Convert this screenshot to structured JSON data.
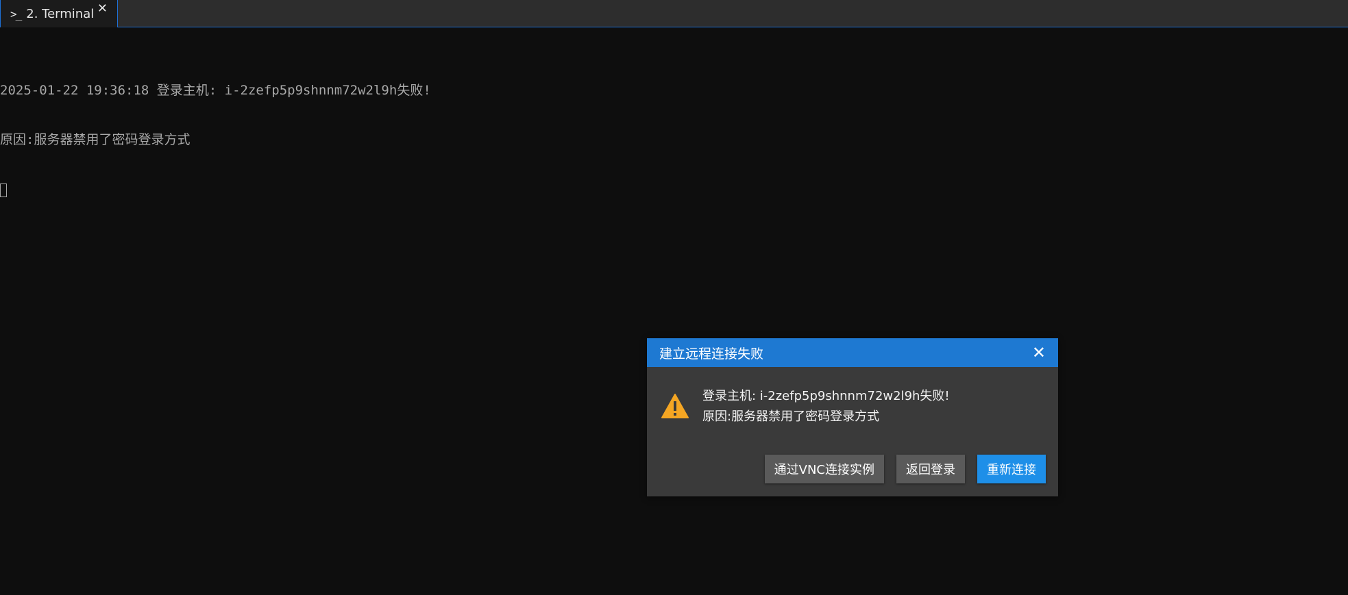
{
  "tabbar": {
    "tab": {
      "icon": "terminal-prompt-icon",
      "icon_glyph": ">_",
      "label": "2. Terminal",
      "close_glyph": "✕"
    }
  },
  "terminal": {
    "line1": "2025-01-22 19:36:18 登录主机: i-2zefp5p9shnnm72w2l9h失败!",
    "line2": "原因:服务器禁用了密码登录方式"
  },
  "dialog": {
    "title": "建立远程连接失败",
    "close_glyph": "✕",
    "icon": "warning-icon",
    "message_line1": "登录主机: i-2zefp5p9shnnm72w2l9h失败!",
    "message_line2": "原因:服务器禁用了密码登录方式",
    "buttons": {
      "vnc": "通过VNC连接实例",
      "back": "返回登录",
      "reconnect": "重新连接"
    }
  },
  "colors": {
    "accent": "#1e79d2",
    "primary_button": "#1e8fe8",
    "warning": "#f5a623",
    "background": "#0e0e0e"
  }
}
